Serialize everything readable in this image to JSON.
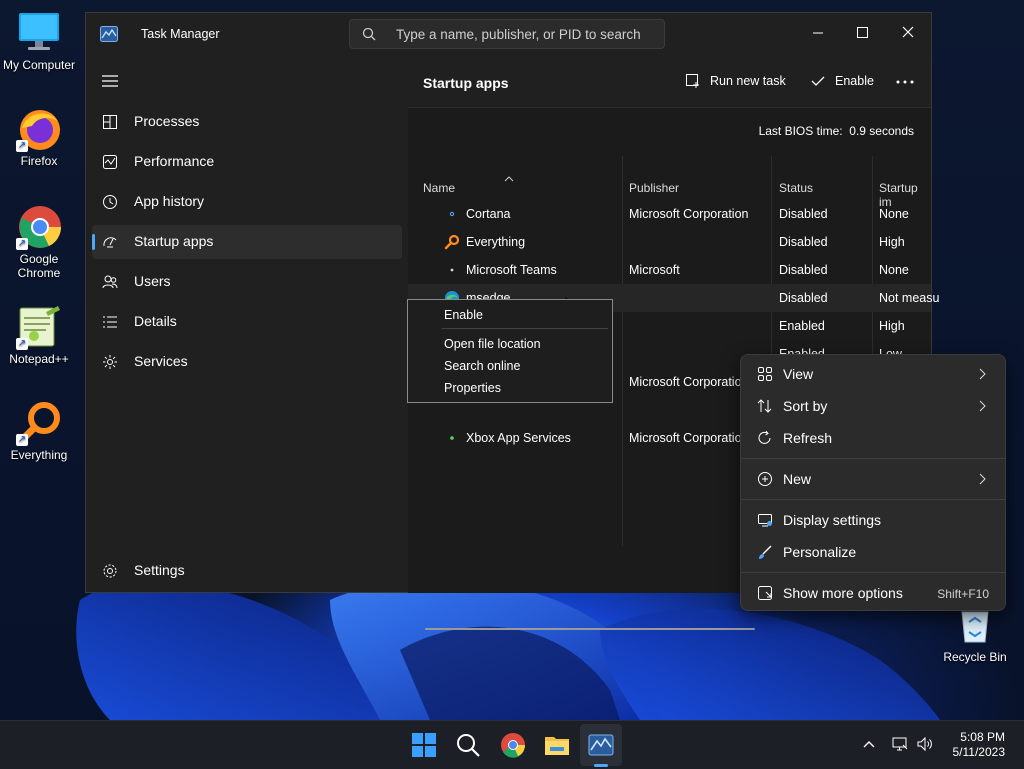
{
  "desktop": {
    "icons": [
      {
        "label": "My Computer"
      },
      {
        "label": "Firefox"
      },
      {
        "label": "Google Chrome"
      },
      {
        "label": "Notepad++"
      },
      {
        "label": "Everything"
      },
      {
        "label": "Recycle Bin"
      }
    ]
  },
  "taskmanager": {
    "title": "Task Manager",
    "search_placeholder": "Type a name, publisher, or PID to search",
    "nav": [
      {
        "label": "Processes",
        "icon": "processes-icon"
      },
      {
        "label": "Performance",
        "icon": "performance-icon"
      },
      {
        "label": "App history",
        "icon": "app-history-icon"
      },
      {
        "label": "Startup apps",
        "icon": "startup-apps-icon",
        "selected": true
      },
      {
        "label": "Users",
        "icon": "users-icon"
      },
      {
        "label": "Details",
        "icon": "details-icon"
      },
      {
        "label": "Services",
        "icon": "services-icon"
      }
    ],
    "settings_label": "Settings",
    "page_title": "Startup apps",
    "run_new_task": "Run new task",
    "enable": "Enable",
    "bios_label": "Last BIOS time:",
    "bios_value": "0.9 seconds",
    "columns": [
      "Name",
      "Publisher",
      "Status",
      "Startup im"
    ],
    "rows": [
      {
        "name": "Cortana",
        "publisher": "Microsoft Corporation",
        "status": "Disabled",
        "impact": "None"
      },
      {
        "name": "Everything",
        "publisher": "",
        "status": "Disabled",
        "impact": "High"
      },
      {
        "name": "Microsoft Teams",
        "publisher": "Microsoft",
        "status": "Disabled",
        "impact": "None"
      },
      {
        "name": "msedge",
        "publisher": "",
        "status": "Disabled",
        "impact": "Not measu"
      },
      {
        "name": "",
        "publisher": "",
        "status": "Enabled",
        "impact": "High"
      },
      {
        "name": "",
        "publisher": "",
        "status": "Enabled",
        "impact": "Low"
      },
      {
        "name": "",
        "publisher": "Microsoft Corporation",
        "status": "",
        "impact": ""
      },
      {
        "name": "",
        "publisher": "",
        "status": "",
        "impact": ""
      },
      {
        "name": "Xbox App Services",
        "publisher": "Microsoft Corporation",
        "status": "",
        "impact": ""
      }
    ]
  },
  "row_menu": {
    "items": [
      "Enable",
      "Open file location",
      "Search online",
      "Properties"
    ]
  },
  "desktop_menu": {
    "items": [
      {
        "label": "View",
        "icon": "view-grid-icon",
        "submenu": true
      },
      {
        "label": "Sort by",
        "icon": "sort-icon",
        "submenu": true
      },
      {
        "label": "Refresh",
        "icon": "refresh-icon"
      },
      {
        "label": "New",
        "icon": "new-plus-icon",
        "submenu": true
      },
      {
        "label": "Display settings",
        "icon": "display-settings-icon"
      },
      {
        "label": "Personalize",
        "icon": "personalize-brush-icon"
      },
      {
        "label": "Show more options",
        "icon": "more-options-icon",
        "shortcut": "Shift+F10"
      }
    ]
  },
  "taskbar": {
    "time": "5:08 PM",
    "date": "5/11/2023"
  },
  "colors": {
    "accent": "#4aa8ff",
    "window_bg": "#202020",
    "menu_bg": "#2b2b2b"
  }
}
